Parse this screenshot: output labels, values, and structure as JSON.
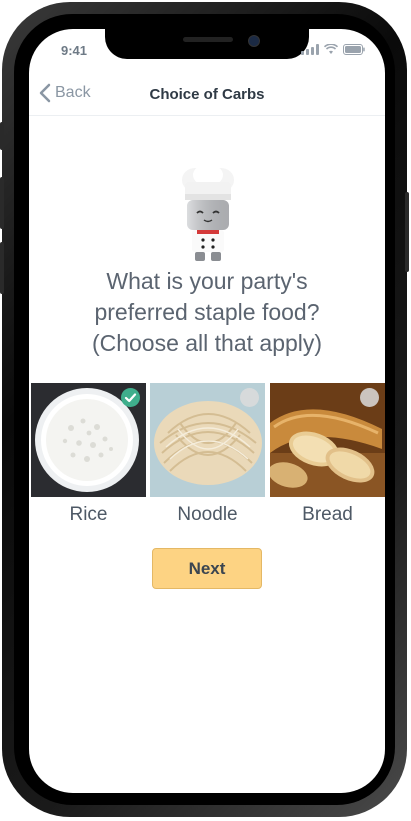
{
  "status": {
    "time": "9:41"
  },
  "nav": {
    "back_label": "Back",
    "title": "Choice of Carbs"
  },
  "question": {
    "line1": "What is your party's",
    "line2": "preferred staple food?",
    "line3": "(Choose all that apply)"
  },
  "options": [
    {
      "label": "Rice",
      "selected": true,
      "icon": "rice-bowl"
    },
    {
      "label": "Noodle",
      "selected": false,
      "icon": "noodle-bundle"
    },
    {
      "label": "Bread",
      "selected": false,
      "icon": "baguette-slices"
    }
  ],
  "next": {
    "label": "Next"
  },
  "colors": {
    "accent": "#3fae8c",
    "button": "#fdd383",
    "title": "#2f3a45",
    "text": "#5b6470"
  }
}
